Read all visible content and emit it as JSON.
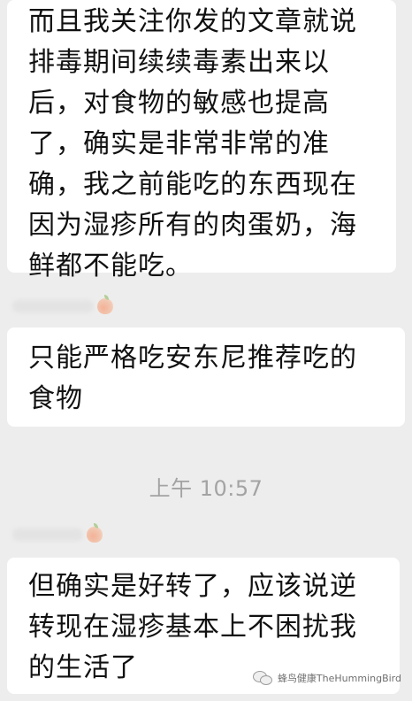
{
  "messages": [
    {
      "text": "而且我关注你发的文章就说\n排毒期间续续毒素出来以\n后，对食物的敏感也提高\n了，确实是非常非常的准\n确，我之前能吃的东西现在\n因为湿疹所有的肉蛋奶，海\n鲜都不能吃。"
    },
    {
      "text": "只能严格吃安东尼推荐吃的\n食物"
    },
    {
      "text": "但确实是好转了，应该说逆\n转现在湿疹基本上不困扰我\n的生活了"
    }
  ],
  "timestamp": "上午 10:57",
  "watermark": {
    "text": "蜂鸟健康TheHummingBird",
    "icon": "wechat-icon"
  },
  "sender_icon": "peach-icon",
  "colors": {
    "background": "#ededed",
    "bubble": "#ffffff",
    "text": "#111111",
    "timestamp": "#a3a3a3"
  }
}
